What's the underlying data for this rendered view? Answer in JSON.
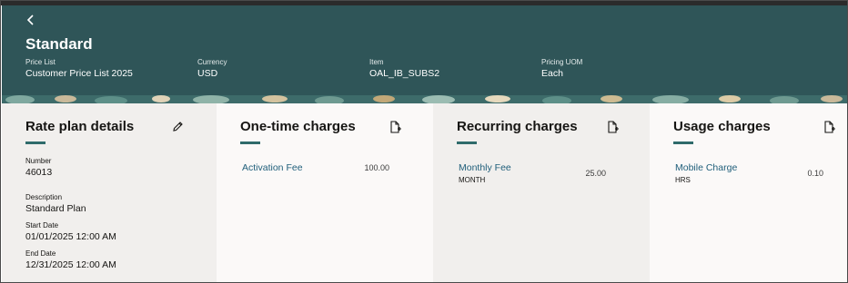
{
  "header": {
    "title": "Standard",
    "meta": [
      {
        "label": "Price List",
        "value": "Customer Price List 2025"
      },
      {
        "label": "Currency",
        "value": "USD"
      },
      {
        "label": "Item",
        "value": "OAL_IB_SUBS2"
      },
      {
        "label": "Pricing UOM",
        "value": "Each"
      }
    ]
  },
  "rate_plan": {
    "title": "Rate plan details",
    "fields": [
      {
        "label": "Number",
        "value": "46013"
      },
      {
        "label": "Description",
        "value": "Standard Plan"
      },
      {
        "label": "Start Date",
        "value": "01/01/2025 12:00 AM"
      },
      {
        "label": "End Date",
        "value": "12/31/2025 12:00 AM"
      }
    ]
  },
  "one_time": {
    "title": "One-time charges",
    "items": [
      {
        "name": "Activation Fee",
        "amount": "100.00"
      }
    ]
  },
  "recurring": {
    "title": "Recurring charges",
    "items": [
      {
        "name": "Monthly Fee",
        "sub": "MONTH",
        "amount": "25.00"
      }
    ]
  },
  "usage": {
    "title": "Usage charges",
    "items": [
      {
        "name": "Mobile Charge",
        "sub": "HRS",
        "amount": "0.10"
      }
    ]
  },
  "colors": {
    "header_bg": "#2f5558",
    "link": "#1f5e7a",
    "accent": "#2f6b6b"
  },
  "icons": {
    "back": "chevron-left-icon",
    "edit": "pencil-icon",
    "add": "document-add-icon"
  }
}
